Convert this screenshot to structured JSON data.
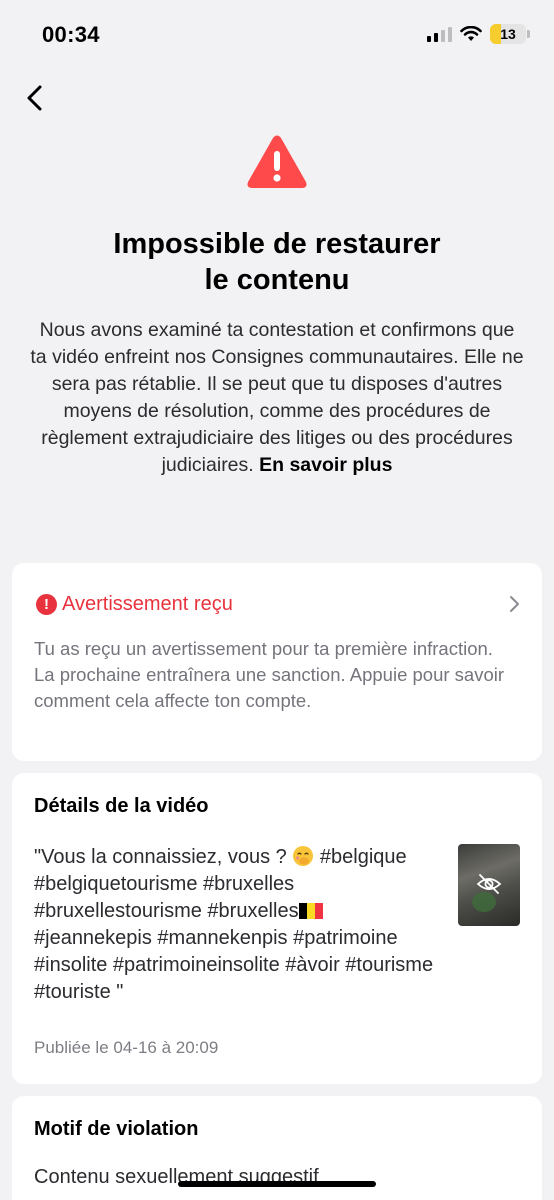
{
  "status_bar": {
    "time": "00:34",
    "battery": "13"
  },
  "page": {
    "title_line1": "Impossible de restaurer",
    "title_line2": "le contenu",
    "description": "Nous avons examiné ta contestation et confirmons que ta vidéo enfreint nos Consignes communautaires. Elle ne sera pas rétablie. Il se peut que tu disposes d'autres moyens de résolution, comme des procédures de règlement extrajudiciaire des litiges ou des procédures judiciaires.",
    "learn_more": "En savoir plus"
  },
  "warning_card": {
    "label": "Avertissement reçu",
    "description": "Tu as reçu un avertissement pour ta première infraction. La prochaine entraînera une sanction. Appuie pour savoir comment cela affecte ton compte."
  },
  "video_card": {
    "heading": "Détails de la vidéo",
    "caption_part1": "\"Vous la connaissiez, vous ? ",
    "caption_part2": " #belgique #belgiquetourisme #bruxelles #bruxellestourisme #bruxelles",
    "caption_part3": " #jeannekepis #mannekenpis #patrimoine #insolite #patrimoineinsolite #àvoir #tourisme #touriste \"",
    "date": "Publiée le 04-16 à 20:09"
  },
  "violation_card": {
    "heading": "Motif de violation",
    "reason": "Contenu sexuellement suggestif"
  },
  "colors": {
    "accent_red": "#e8333e",
    "warning_red": "#fe4a4a",
    "background": "#f2f2f4"
  }
}
